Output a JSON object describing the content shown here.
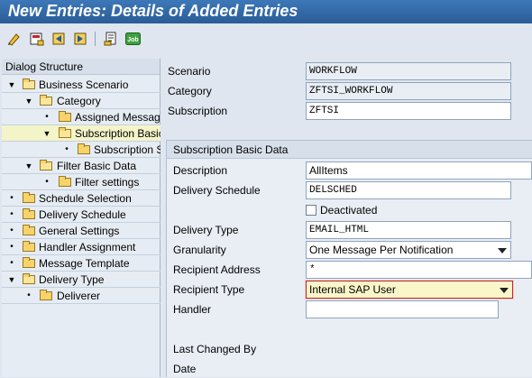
{
  "window": {
    "title": "New Entries: Details of Added Entries"
  },
  "toolbar": {
    "icons": [
      "edit-icon",
      "save-entry-icon",
      "previous-entry-icon",
      "next-entry-icon",
      "document-icon",
      "job-icon"
    ],
    "job_label": "Job"
  },
  "dialog_structure": {
    "title": "Dialog Structure",
    "items": [
      {
        "label": "Business Scenario",
        "toggle": "▼"
      },
      {
        "label": "Category",
        "toggle": "▼"
      },
      {
        "label": "Assigned Messages",
        "toggle": "•"
      },
      {
        "label": "Subscription Basic Data",
        "toggle": "▼"
      },
      {
        "label": "Subscription Settings",
        "toggle": "•"
      },
      {
        "label": "Filter Basic Data",
        "toggle": "▼"
      },
      {
        "label": "Filter settings",
        "toggle": "•"
      },
      {
        "label": "Schedule Selection",
        "toggle": "•"
      },
      {
        "label": "Delivery Schedule",
        "toggle": "•"
      },
      {
        "label": "General Settings",
        "toggle": "•"
      },
      {
        "label": "Handler Assignment",
        "toggle": "•"
      },
      {
        "label": "Message Template",
        "toggle": "•"
      },
      {
        "label": "Delivery Type",
        "toggle": "▼"
      },
      {
        "label": "Deliverer",
        "toggle": "•"
      }
    ]
  },
  "header_fields": {
    "scenario": {
      "label": "Scenario",
      "value": "WORKFLOW"
    },
    "category": {
      "label": "Category",
      "value": "ZFTSI_WORKFLOW"
    },
    "subscription": {
      "label": "Subscription",
      "value": "ZFTSI"
    }
  },
  "group": {
    "title": "Subscription Basic Data",
    "description": {
      "label": "Description",
      "value": "AllItems"
    },
    "delivery_schedule": {
      "label": "Delivery Schedule",
      "value": "DELSCHED"
    },
    "deactivated": {
      "label": "Deactivated",
      "checked": false
    },
    "delivery_type": {
      "label": "Delivery Type",
      "value": "EMAIL_HTML"
    },
    "granularity": {
      "label": "Granularity",
      "value": "One Message Per Notification"
    },
    "recipient_address": {
      "label": "Recipient Address",
      "value": "*"
    },
    "recipient_type": {
      "label": "Recipient Type",
      "value": "Internal SAP User"
    },
    "handler": {
      "label": "Handler",
      "value": ""
    },
    "last_changed_by": {
      "label": "Last Changed By",
      "value": ""
    },
    "date": {
      "label": "Date",
      "value": ""
    }
  },
  "colors": {
    "title_bar": "#2f67a8",
    "background": "#dfe6ef",
    "selected_row": "#f4f4c9",
    "focus_border": "#c0262d"
  }
}
